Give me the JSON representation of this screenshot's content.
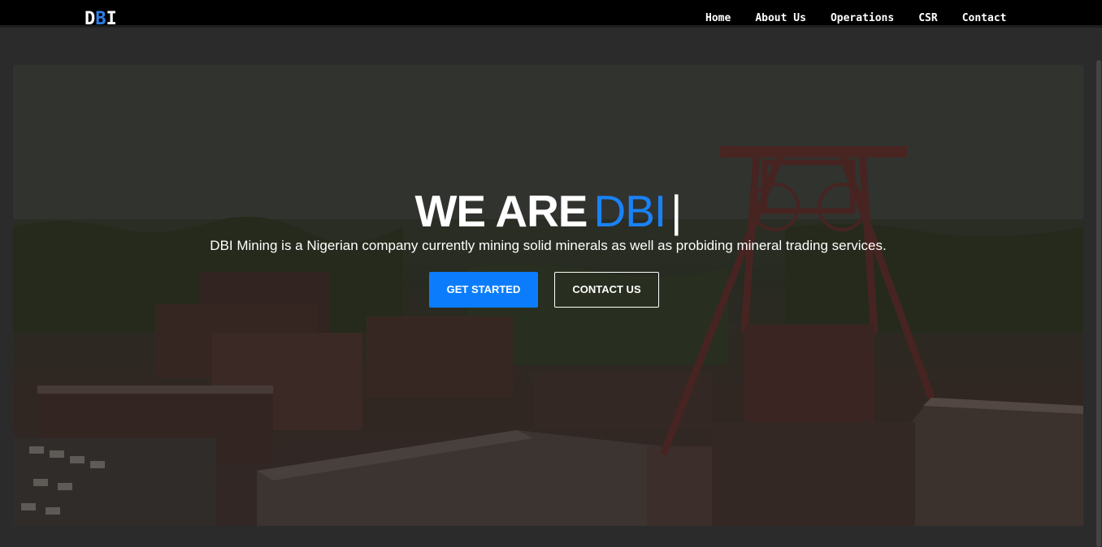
{
  "nav": {
    "logo_prefix": "D",
    "logo_accent": "B",
    "logo_suffix": "I",
    "links": [
      "Home",
      "About Us",
      "Operations",
      "CSR",
      "Contact"
    ]
  },
  "hero": {
    "title_lead": "WE ARE",
    "title_accent": "DBI",
    "cursor": "|",
    "subtitle": "DBI Mining is a Nigerian company currently mining solid minerals as well as probiding mineral trading services.",
    "primary_button": "GET STARTED",
    "secondary_button": "CONTACT US"
  },
  "colors": {
    "accent": "#1a82f7",
    "button_primary": "#0b7dfc",
    "navbar": "#000000"
  }
}
